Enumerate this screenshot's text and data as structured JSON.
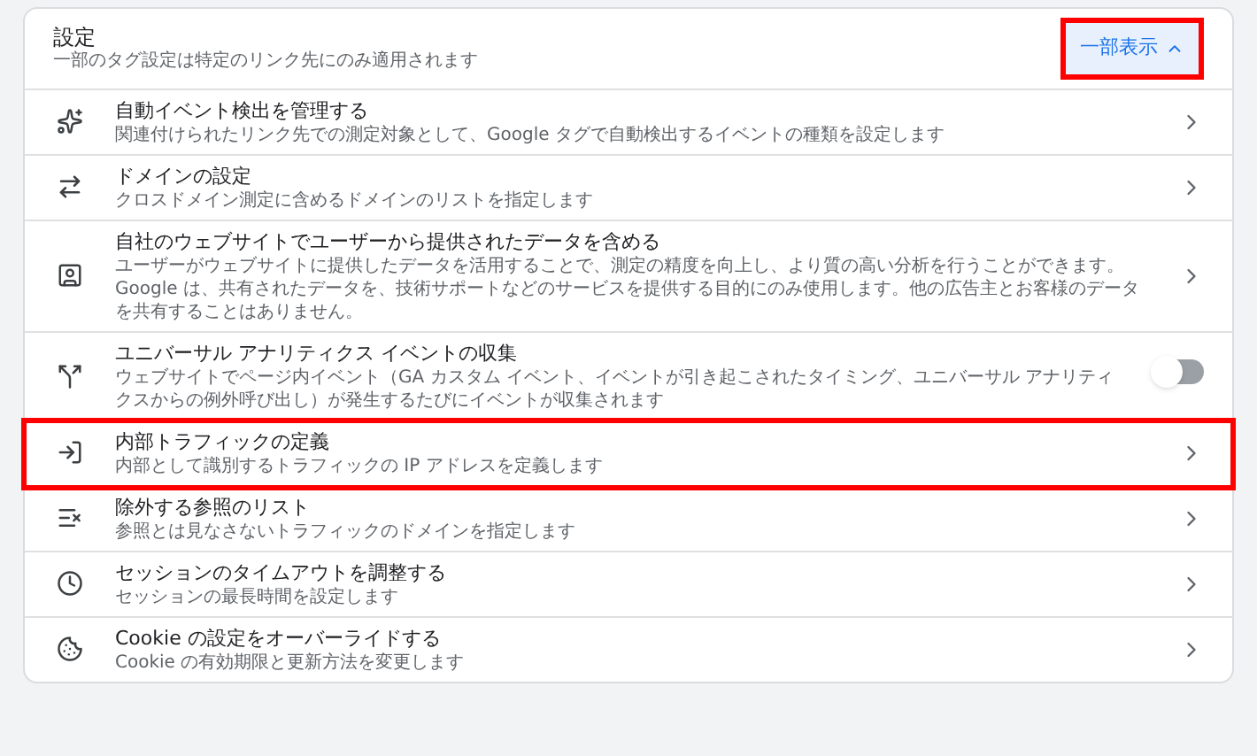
{
  "header": {
    "title": "設定",
    "subtitle": "一部のタグ設定は特定のリンク先にのみ適用されます",
    "toggle_button": {
      "label": "一部表示",
      "expanded": true,
      "highlighted": true
    }
  },
  "items": [
    {
      "kind": "link",
      "title": "自動イベント検出を管理する",
      "description": "関連付けられたリンク先での測定対象として、Google タグで自動検出するイベントの種類を設定します",
      "highlighted": false
    },
    {
      "kind": "link",
      "title": "ドメインの設定",
      "description": "クロスドメイン測定に含めるドメインのリストを指定します",
      "highlighted": false
    },
    {
      "kind": "link",
      "title": "自社のウェブサイトでユーザーから提供されたデータを含める",
      "description": "ユーザーがウェブサイトに提供したデータを活用することで、測定の精度を向上し、より質の高い分析を行うことができます。Google は、共有されたデータを、技術サポートなどのサービスを提供する目的にのみ使用します。他の広告主とお客様のデータを共有することはありません。",
      "highlighted": false
    },
    {
      "kind": "toggle",
      "title": "ユニバーサル アナリティクス イベントの収集",
      "description": "ウェブサイトでページ内イベント（GA カスタム イベント、イベントが引き起こされたタイミング、ユニバーサル アナリティクスからの例外呼び出し）が発生するたびにイベントが収集されます",
      "on": false,
      "highlighted": false
    },
    {
      "kind": "link",
      "title": "内部トラフィックの定義",
      "description": "内部として識別するトラフィックの IP アドレスを定義します",
      "highlighted": true
    },
    {
      "kind": "link",
      "title": "除外する参照のリスト",
      "description": "参照とは見なさないトラフィックのドメインを指定します",
      "highlighted": false
    },
    {
      "kind": "link",
      "title": "セッションのタイムアウトを調整する",
      "description": "セッションの最長時間を設定します",
      "highlighted": false
    },
    {
      "kind": "link",
      "title": "Cookie の設定をオーバーライドする",
      "description": "Cookie の有効期限と更新方法を変更します",
      "highlighted": false
    }
  ]
}
